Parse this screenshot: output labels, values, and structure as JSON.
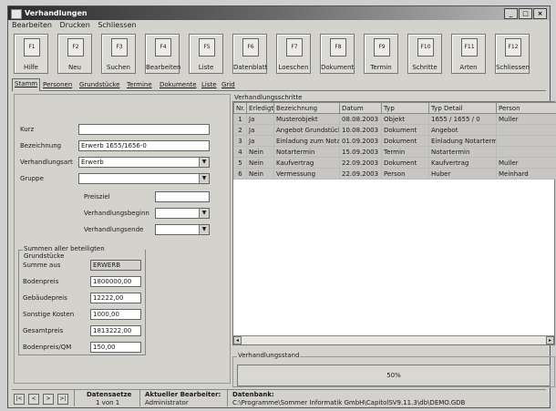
{
  "window": {
    "title": "Verhandlungen",
    "controls": [
      "_",
      "□",
      "×"
    ]
  },
  "menu": [
    "Bearbeiten",
    "Drucken",
    "Schliessen"
  ],
  "toolbar": [
    {
      "key": "F1",
      "label": "Hilfe"
    },
    {
      "key": "F2",
      "label": "Neu"
    },
    {
      "key": "F3",
      "label": "Suchen"
    },
    {
      "key": "F4",
      "label": "Bearbeiten"
    },
    {
      "key": "F5",
      "label": "Liste"
    },
    {
      "key": "F6",
      "label": "Datenblatt"
    },
    {
      "key": "F7",
      "label": "Loeschen"
    },
    {
      "key": "F8",
      "label": "Dokument"
    },
    {
      "key": "F9",
      "label": "Termin"
    },
    {
      "key": "F10",
      "label": "Schritte"
    },
    {
      "key": "F11",
      "label": "Arten"
    },
    {
      "key": "F12",
      "label": "Schliessen"
    }
  ],
  "tabs": [
    "Stamm",
    "Personen",
    "Grundstücke",
    "Termine",
    "Dokumente",
    "Liste",
    "Grid"
  ],
  "form": {
    "kurz_label": "Kurz",
    "kurz_value": "",
    "bezeichnung_label": "Bezeichnung",
    "bezeichnung_value": "Erwerb 1655/1656-0",
    "verhandlungsart_label": "Verhandlungsart",
    "verhandlungsart_value": "Erwerb",
    "gruppe_label": "Gruppe",
    "gruppe_value": "",
    "preisziel_label": "Preisziel",
    "beginn_label": "Verhandlungsbeginn",
    "ende_label": "Verhandlungsende"
  },
  "summen": {
    "title": "Summen aller beteiligten Grundstücke",
    "rows": [
      {
        "label": "Summe aus",
        "value": "ERWERB",
        "gray": true
      },
      {
        "label": "Bodenpreis",
        "value": "1800000,00"
      },
      {
        "label": "Gebäudepreis",
        "value": "12222,00"
      },
      {
        "label": "Sonstige Kosten",
        "value": "1000,00"
      },
      {
        "label": "Gesamtpreis",
        "value": "1813222,00"
      },
      {
        "label": "Bodenpreis/QM",
        "value": "150,00"
      }
    ]
  },
  "steps": {
    "title": "Verhandlungsschritte",
    "columns": [
      "Nr.",
      "Erledigt",
      "Bezeichnung",
      "Datum",
      "Typ",
      "Typ Detail",
      "Person"
    ],
    "rows": [
      [
        "1",
        "Ja",
        "Musterobjekt",
        "08.08.2003",
        "Objekt",
        "1655 / 1655 / 0",
        "Muller"
      ],
      [
        "2",
        "Ja",
        "Angebot Grundstück",
        "10.08.2003",
        "Dokument",
        "Angebot",
        ""
      ],
      [
        "3",
        "Ja",
        "Einladung zum Notar",
        "01.09.2003",
        "Dokument",
        "Einladung Notartermi",
        ""
      ],
      [
        "4",
        "Nein",
        "Notartermin",
        "15.09.2003",
        "Termin",
        "Notartermin",
        ""
      ],
      [
        "5",
        "Nein",
        "Kaufvertrag",
        "22.09.2003",
        "Dokument",
        "Kaufvertrag",
        "Muller"
      ],
      [
        "6",
        "Nein",
        "Vermessung",
        "22.09.2003",
        "Person",
        "Huber",
        "Meinhard"
      ]
    ]
  },
  "progress": {
    "title": "Verhandlungsstand",
    "value": 50,
    "text": "50%"
  },
  "status": {
    "nav": [
      "|<",
      "<",
      ">",
      ">|"
    ],
    "datensaetze_label": "Datensaetze",
    "datensaetze_value": "1 von 1",
    "bearbeiter_label": "Aktueller Bearbeiter:",
    "bearbeiter_value": "Administrator",
    "datenbank_label": "Datenbank:",
    "datenbank_value": "C:\\Programme\\Sommer Informatik GmbH\\CapitolSV9.11.3\\db\\DEMO.GDB"
  }
}
